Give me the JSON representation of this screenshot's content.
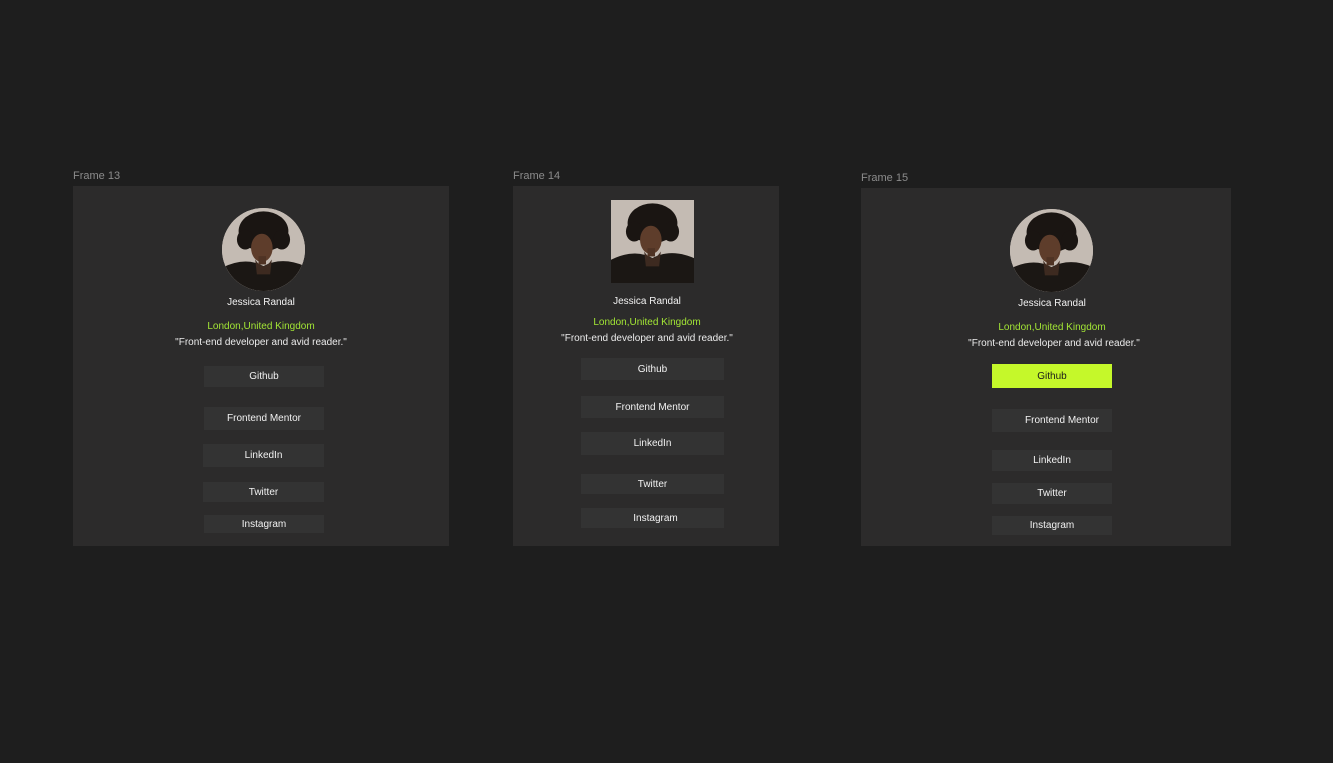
{
  "frames": [
    {
      "label": "Frame 13",
      "profile": {
        "name": "Jessica Randal",
        "location": "London,United Kingdom",
        "bio": "\"Front-end developer and avid reader.\""
      },
      "avatar_shape": "circle",
      "links": [
        "Github",
        "Frontend Mentor",
        "LinkedIn",
        "Twitter",
        "Instagram"
      ]
    },
    {
      "label": "Frame 14",
      "profile": {
        "name": "Jessica Randal",
        "location": "London,United Kingdom",
        "bio": "\"Front-end developer and avid reader.\""
      },
      "avatar_shape": "square",
      "links": [
        "Github",
        "Frontend Mentor",
        "LinkedIn",
        "Twitter",
        "Instagram"
      ]
    },
    {
      "label": "Frame 15",
      "profile": {
        "name": "Jessica Randal",
        "location": "London,United Kingdom",
        "bio": "\"Front-end developer and avid reader.\""
      },
      "avatar_shape": "circle",
      "active_link": "Github",
      "links": [
        "Github",
        "Frontend Mentor",
        "LinkedIn",
        "Twitter",
        "Instagram"
      ]
    }
  ],
  "colors": {
    "canvas_background": "#1e1e1e",
    "card_background": "#2c2b2b",
    "button_background": "#333333",
    "accent_green": "#c5f82a",
    "location_green": "#a3e635",
    "frame_label": "#8c8c8c"
  }
}
